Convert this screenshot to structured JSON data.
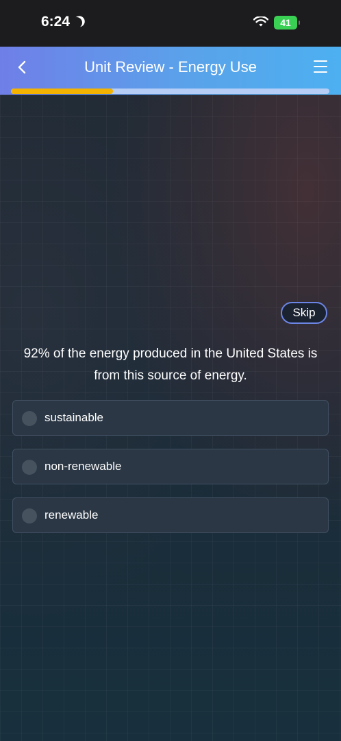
{
  "status_bar": {
    "time": "6:24",
    "battery": "41"
  },
  "header": {
    "title": "Unit Review - Energy Use",
    "progress": 0.32
  },
  "skip_label": "Skip",
  "question": "92% of the energy produced in the United States is from this source of energy.",
  "options": [
    {
      "label": "sustainable"
    },
    {
      "label": "non-renewable"
    },
    {
      "label": "renewable"
    }
  ],
  "colors": {
    "accent": "#f3b300",
    "header_start": "#6f7fe8",
    "header_end": "#4db0f0",
    "battery": "#3ad054"
  }
}
